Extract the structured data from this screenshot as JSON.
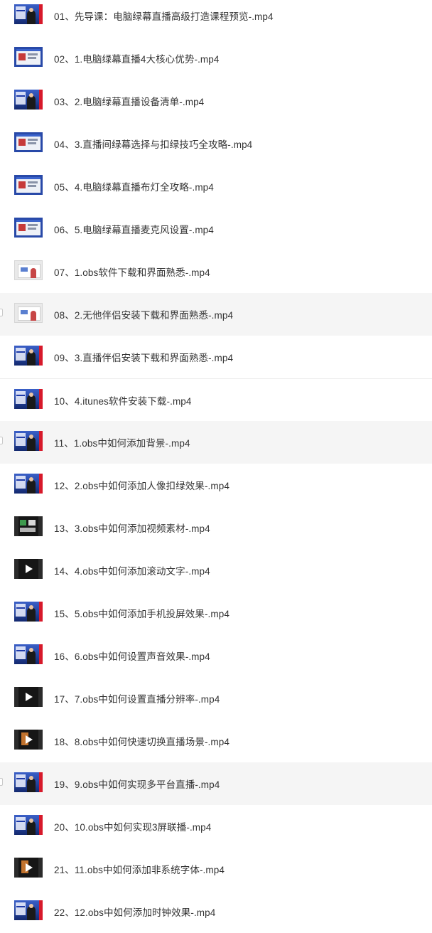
{
  "files": [
    {
      "name": "01、先导课：电脑绿幕直播高级打造课程预览-.mp4",
      "thumb": "blue"
    },
    {
      "name": "02、1.电脑绿幕直播4大核心优势-.mp4",
      "thumb": "screen"
    },
    {
      "name": "03、2.电脑绿幕直播设备清单-.mp4",
      "thumb": "blue"
    },
    {
      "name": "04、3.直播间绿幕选择与扣绿技巧全攻略-.mp4",
      "thumb": "screen"
    },
    {
      "name": "05、4.电脑绿幕直播布灯全攻略-.mp4",
      "thumb": "screen"
    },
    {
      "name": "06、5.电脑绿幕直播麦克风设置-.mp4",
      "thumb": "screen"
    },
    {
      "name": "07、1.obs软件下载和界面熟悉-.mp4",
      "thumb": "light"
    },
    {
      "name": "08、2.无他伴侣安装下载和界面熟悉-.mp4",
      "thumb": "light"
    },
    {
      "name": "09、3.直播伴侣安装下载和界面熟悉-.mp4",
      "thumb": "blue"
    },
    {
      "name": "10、4.itunes软件安装下载-.mp4",
      "thumb": "blue"
    },
    {
      "name": "11、1.obs中如何添加背景-.mp4",
      "thumb": "blue"
    },
    {
      "name": "12、2.obs中如何添加人像扣绿效果-.mp4",
      "thumb": "blue"
    },
    {
      "name": "13、3.obs中如何添加视频素材-.mp4",
      "thumb": "dark-green"
    },
    {
      "name": "14、4.obs中如何添加滚动文字-.mp4",
      "thumb": "dark"
    },
    {
      "name": "15、5.obs中如何添加手机投屏效果-.mp4",
      "thumb": "blue"
    },
    {
      "name": "16、6.obs中如何设置声音效果-.mp4",
      "thumb": "blue"
    },
    {
      "name": "17、7.obs中如何设置直播分辨率-.mp4",
      "thumb": "dark"
    },
    {
      "name": "18、8.obs中如何快速切换直播场景-.mp4",
      "thumb": "dark-orange"
    },
    {
      "name": "19、9.obs中如何实现多平台直播-.mp4",
      "thumb": "blue"
    },
    {
      "name": "20、10.obs中如何实现3屏联播-.mp4",
      "thumb": "blue"
    },
    {
      "name": "21、11.obs中如何添加非系统字体-.mp4",
      "thumb": "dark-orange"
    },
    {
      "name": "22、12.obs中如何添加时钟效果-.mp4",
      "thumb": "blue"
    }
  ],
  "colors": {
    "row_highlight": "#f5f5f5",
    "text": "#333333",
    "thumb_blue": "#24449e"
  },
  "highlighted_rows": [
    7,
    10,
    18
  ]
}
